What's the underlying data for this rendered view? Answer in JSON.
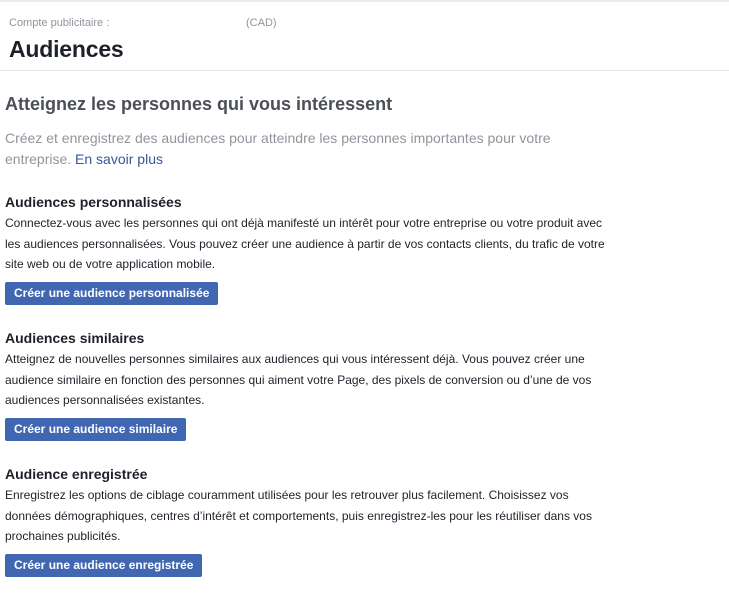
{
  "header": {
    "account_label": "Compte publicitaire :",
    "currency": "(CAD)",
    "title": "Audiences"
  },
  "hero": {
    "title": "Atteignez les personnes qui vous intéressent",
    "description": "Créez et enregistrez des audiences pour atteindre les personnes importantes pour votre entreprise.",
    "learn_more": "En savoir plus"
  },
  "sections": [
    {
      "title": "Audiences personnalisées",
      "text": "Connectez-vous avec les personnes qui ont déjà manifesté un intérêt pour votre entreprise ou votre produit avec les audiences personnalisées. Vous pouvez créer une audience à partir de vos contacts clients, du trafic de votre site web ou de votre application mobile.",
      "button": "Créer une audience personnalisée"
    },
    {
      "title": "Audiences similaires",
      "text": "Atteignez de nouvelles personnes similaires aux audiences qui vous intéressent déjà. Vous pouvez créer une audience similaire en fonction des personnes qui aiment votre Page, des pixels de conversion ou d’une de vos audiences personnalisées existantes.",
      "button": "Créer une audience similaire"
    },
    {
      "title": "Audience enregistrée",
      "text": "Enregistrez les options de ciblage couramment utilisées pour les retrouver plus facilement. Choisissez vos données démographiques, centres d’intérêt et comportements, puis enregistrez-les pour les réutiliser dans vos prochaines publicités.",
      "button": "Créer une audience enregistrée"
    }
  ],
  "colors": {
    "button_bg": "#4267b2",
    "link": "#365899",
    "muted_text": "#90949c"
  }
}
